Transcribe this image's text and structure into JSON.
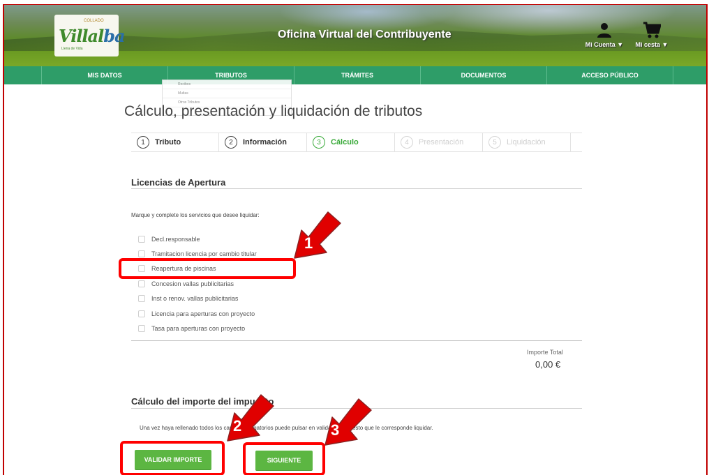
{
  "header": {
    "logo_text_main": "Villalba",
    "logo_text_top": "COLLADO",
    "logo_text_bottom": "Llena de Vida",
    "site_title": "Oficina Virtual del Contribuyente",
    "account_label": "Mi Cuenta ▼",
    "cart_label": "Mi cesta ▼"
  },
  "nav": {
    "items": [
      "MIS DATOS",
      "TRIBUTOS",
      "TRÁMITES",
      "DOCUMENTOS",
      "ACCESO PÚBLICO"
    ]
  },
  "dropdown": {
    "items": [
      "Recibos",
      "Multas",
      "Otros Tributos"
    ]
  },
  "page": {
    "title": "Cálculo, presentación y liquidación de tributos"
  },
  "steps": [
    {
      "num": "1",
      "label": "Tributo",
      "state": "done"
    },
    {
      "num": "2",
      "label": "Información",
      "state": "done"
    },
    {
      "num": "3",
      "label": "Cálculo",
      "state": "active"
    },
    {
      "num": "4",
      "label": "Presentación",
      "state": "disabled"
    },
    {
      "num": "5",
      "label": "Liquidación",
      "state": "disabled"
    }
  ],
  "licencias": {
    "title": "Licencias de Apertura",
    "instruction": "Marque y complete los servicios que desee liquidar:",
    "options": [
      "Decl.responsable",
      "Tramitacion licencia por cambio titular",
      "Reapertura de piscinas",
      "Concesion vallas publicitarias",
      "Inst o renov. vallas publicitarias",
      "Licencia para aperturas con proyecto",
      "Tasa para aperturas con proyecto"
    ],
    "total_label": "Importe Total",
    "total_value": "0,00 €"
  },
  "calculo": {
    "title": "Cálculo del importe del impuesto",
    "text": "Una vez haya rellenado todos los campos obligatorios puede pulsar en validar el impuesto que le corresponde liquidar.",
    "validar_label": "VALIDAR IMPORTE",
    "siguiente_label": "SIGUIENTE"
  },
  "annotations": {
    "arrow_1": "1",
    "arrow_2": "2",
    "arrow_3": "3",
    "color": "#ff0000"
  }
}
